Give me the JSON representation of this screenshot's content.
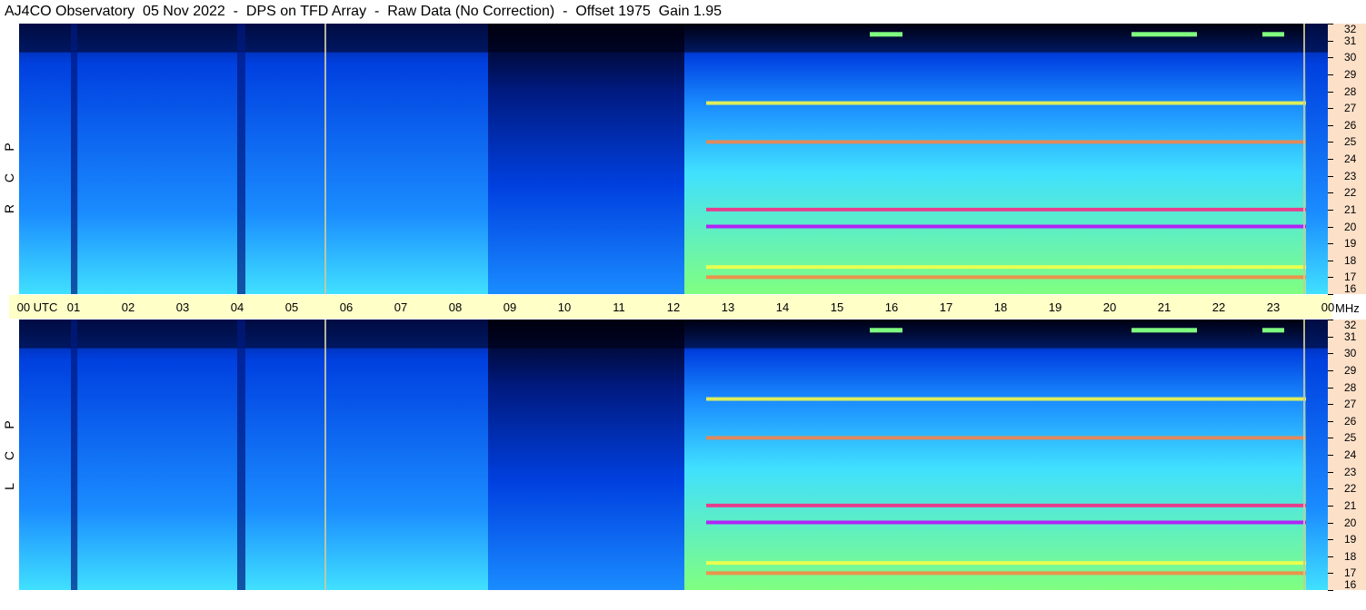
{
  "title": "AJ4CO Observatory  05 Nov 2022  -  DPS on TFD Array  -  Raw Data (No Correction)  -  Offset 1975  Gain 1.95",
  "chart_data": [
    {
      "type": "heatmap",
      "panel": "RCP",
      "side_label": [
        "R",
        "C",
        "P"
      ],
      "x_range_utc_hours": [
        0,
        24
      ],
      "y_range_mhz": [
        16,
        32
      ],
      "y_ticks": [
        "32",
        "31",
        "30",
        "29",
        "28",
        "27",
        "26",
        "25",
        "24",
        "23",
        "22",
        "21",
        "20",
        "19",
        "18",
        "17",
        "16"
      ],
      "colormap": [
        "#000010",
        "#001a80",
        "#0040e0",
        "#1a8cff",
        "#40e0ff",
        "#80ff80",
        "#ffff40",
        "#ff8040",
        "#ff2080",
        "#c000ff"
      ],
      "solar_noise_interval_utc": [
        12.2,
        23.6
      ],
      "bright_bands_mhz": [
        27.3,
        25.0,
        21.0,
        20.0,
        17.6,
        17.0
      ]
    },
    {
      "type": "heatmap",
      "panel": "LCP",
      "side_label": [
        "L",
        "C",
        "P"
      ],
      "x_range_utc_hours": [
        0,
        24
      ],
      "y_range_mhz": [
        16,
        32
      ],
      "y_ticks": [
        "32",
        "31",
        "30",
        "29",
        "28",
        "27",
        "26",
        "25",
        "24",
        "23",
        "22",
        "21",
        "20",
        "19",
        "18",
        "17",
        "16"
      ],
      "colormap": [
        "#000010",
        "#001a80",
        "#0040e0",
        "#1a8cff",
        "#40e0ff",
        "#80ff80",
        "#ffff40",
        "#ff8040",
        "#ff2080",
        "#c000ff"
      ],
      "solar_noise_interval_utc": [
        12.2,
        23.6
      ],
      "bright_bands_mhz": [
        27.3,
        25.0,
        21.0,
        20.0,
        17.6,
        17.0
      ]
    }
  ],
  "time_axis": {
    "labels": [
      "00  UTC",
      "01",
      "02",
      "03",
      "04",
      "05",
      "06",
      "07",
      "08",
      "09",
      "10",
      "11",
      "12",
      "13",
      "14",
      "15",
      "16",
      "17",
      "18",
      "19",
      "20",
      "21",
      "22",
      "23",
      "00"
    ],
    "unit": "MHz"
  }
}
